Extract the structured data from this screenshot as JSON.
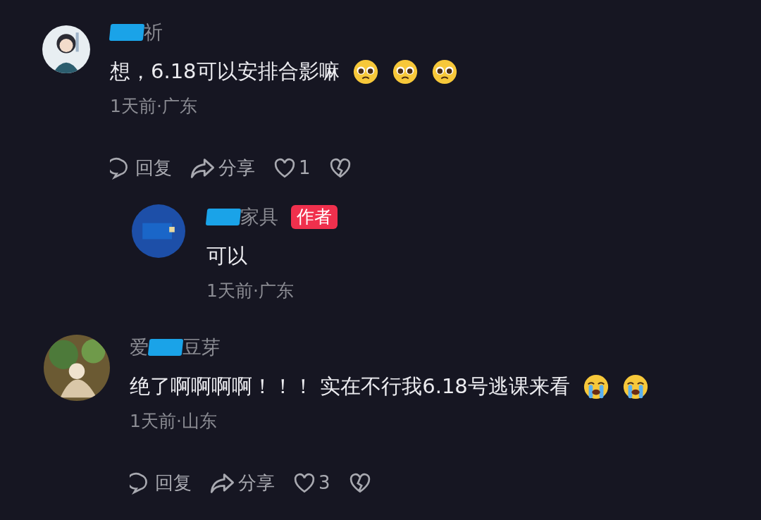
{
  "comments": [
    {
      "name": [
        {
          "kind": "redaction"
        },
        {
          "kind": "text",
          "text": "祈"
        }
      ],
      "text": "想，6.18可以安排合影嘛",
      "emojis": [
        {
          "kind": "pleading"
        },
        {
          "kind": "pleading"
        },
        {
          "kind": "pleading"
        }
      ],
      "meta": "1天前·广东",
      "actions": {
        "reply": "回复",
        "share": "分享",
        "likes": "1"
      },
      "replies": [
        {
          "name": [
            {
              "kind": "redaction"
            },
            {
              "kind": "text",
              "text": "家具"
            }
          ],
          "badge": "作者",
          "text": "可以",
          "meta": "1天前·广东"
        }
      ]
    },
    {
      "name": [
        {
          "kind": "text",
          "text": "爱"
        },
        {
          "kind": "redaction"
        },
        {
          "kind": "text",
          "text": "豆芽"
        }
      ],
      "text": "绝了啊啊啊啊！！！ 实在不行我6.18号逃课来看",
      "emojis": [
        {
          "kind": "crying"
        },
        {
          "kind": "crying"
        }
      ],
      "meta": "1天前·山东",
      "actions": {
        "reply": "回复",
        "share": "分享",
        "likes": "3"
      }
    }
  ]
}
